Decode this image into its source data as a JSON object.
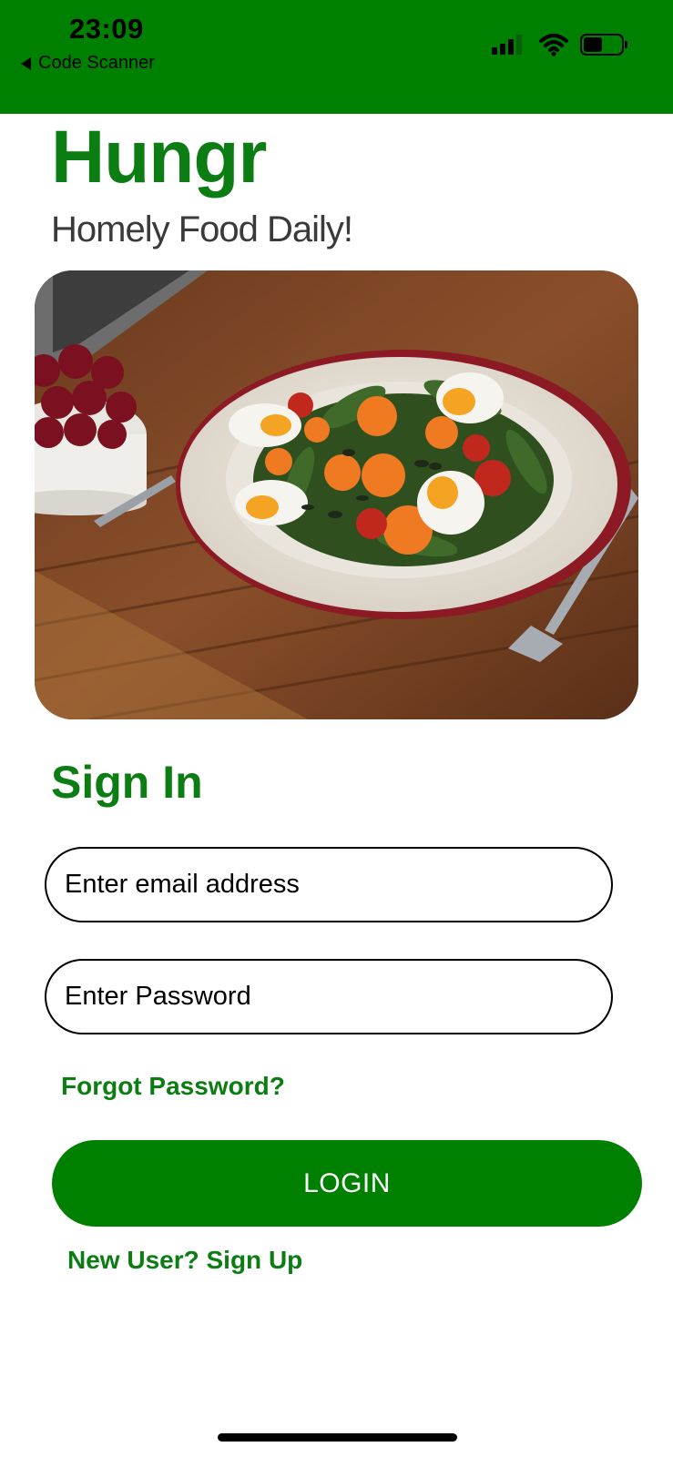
{
  "status_bar": {
    "time": "23:09",
    "back_label": "Code Scanner",
    "background_color": "#008000",
    "icons": [
      "cellular-signal-icon",
      "wifi-icon",
      "battery-icon"
    ],
    "battery_level": 0.5
  },
  "brand": {
    "title": "Hungr",
    "tagline": "Homely Food Daily!",
    "color": "#0b7d12"
  },
  "hero_image": {
    "description_icon": "salad-bowl-photo"
  },
  "signin": {
    "title": "Sign In",
    "email_placeholder": "Enter email address",
    "email_value": "",
    "password_placeholder": "Enter Password",
    "password_value": "",
    "forgot_label": "Forgot Password?",
    "login_label": "LOGIN",
    "signup_label": "New User? Sign Up",
    "accent_color": "#008000"
  }
}
